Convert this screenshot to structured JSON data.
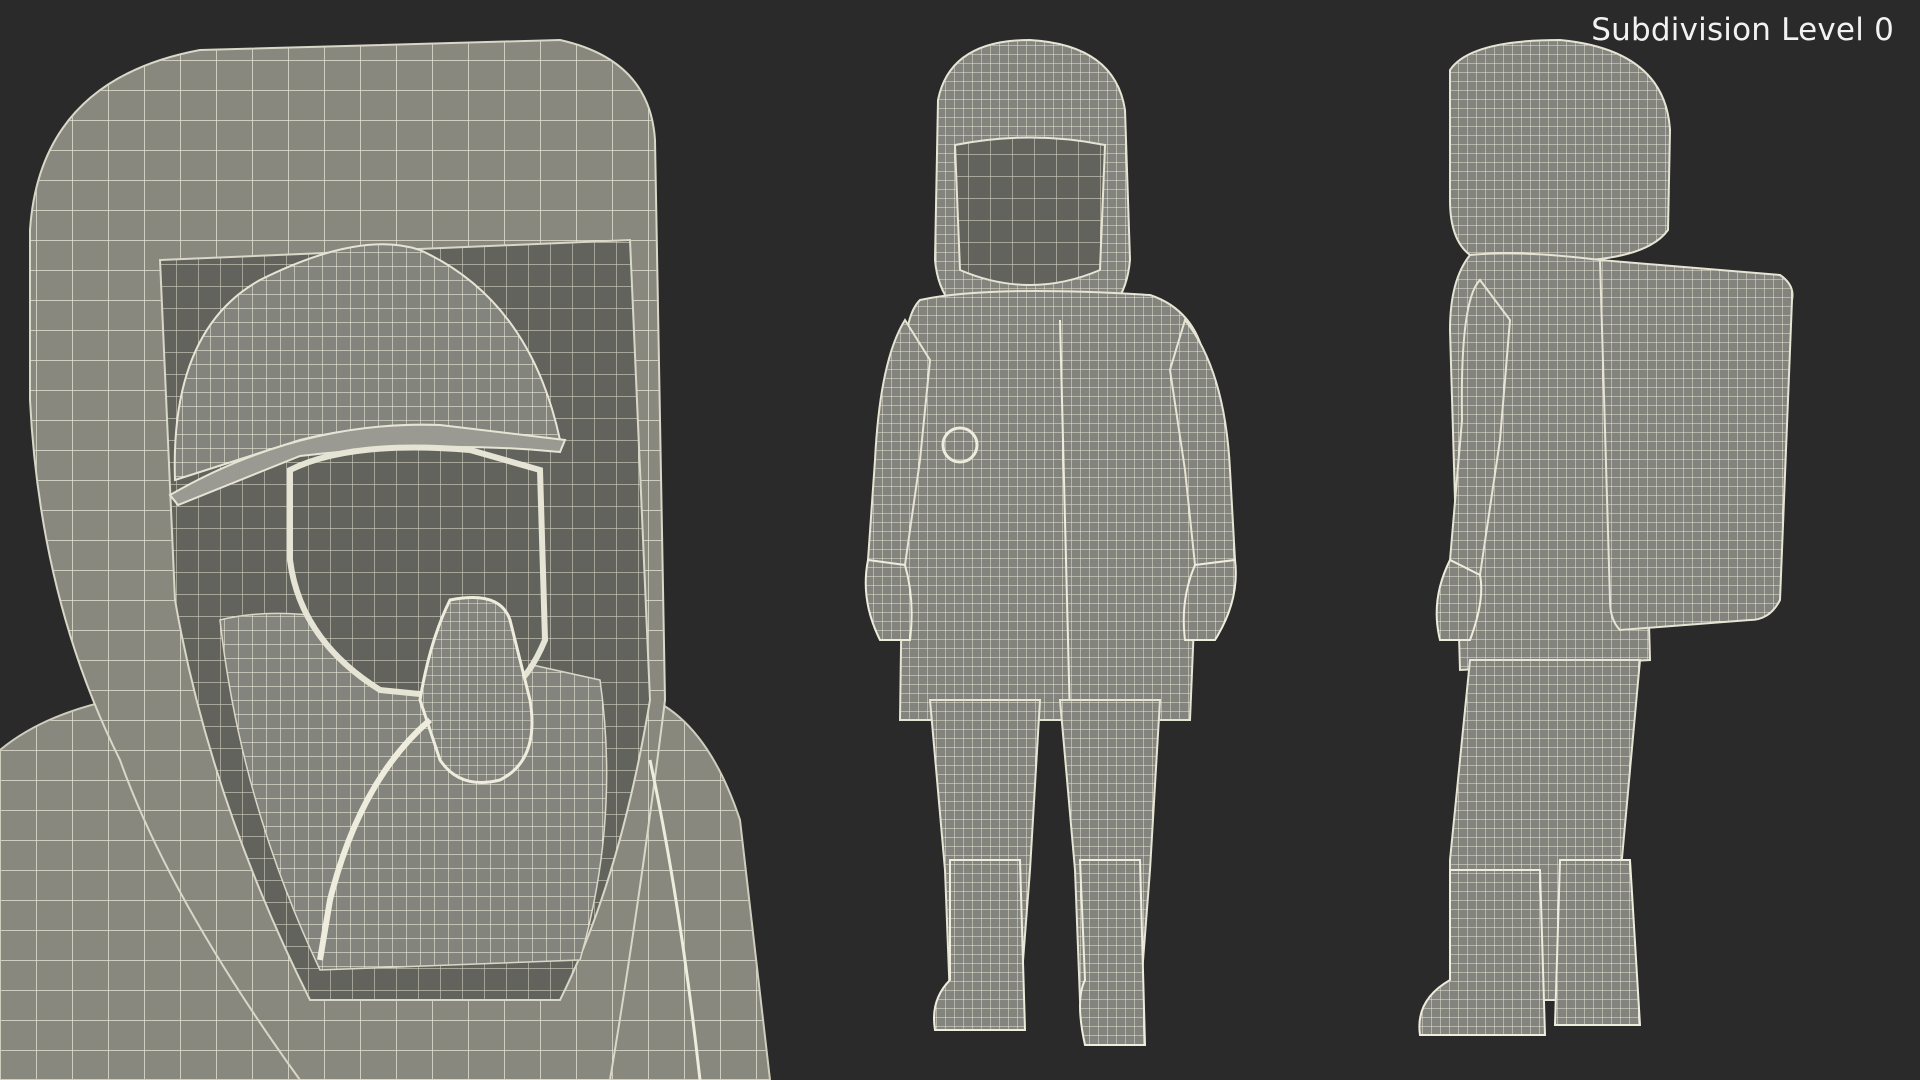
{
  "viewport": {
    "label": "Subdivision Level 0"
  },
  "colors": {
    "background": "#2a2a2a",
    "mesh_fill": "#868680",
    "mesh_shadow": "#5e5e59",
    "wireframe": "#e8e6d6"
  },
  "views": [
    {
      "id": "closeup-head"
    },
    {
      "id": "front-full-body"
    },
    {
      "id": "side-full-body"
    }
  ]
}
